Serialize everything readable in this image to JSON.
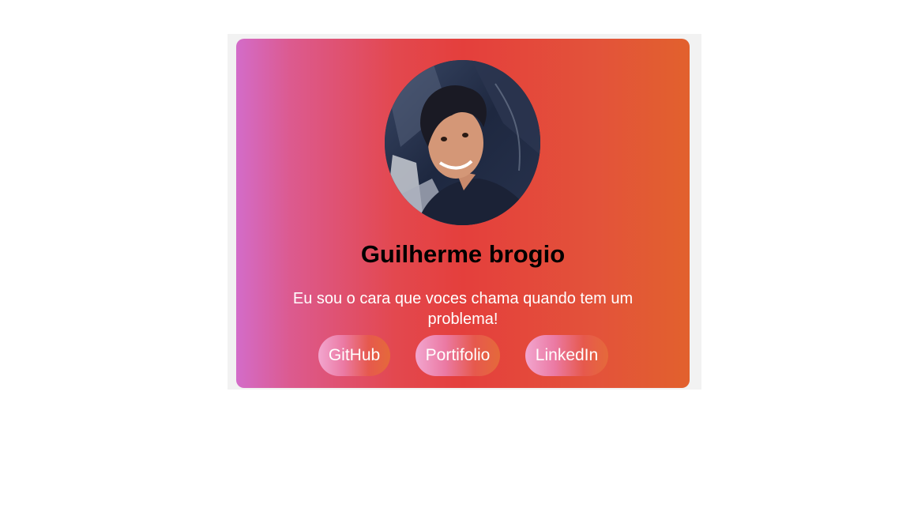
{
  "profile": {
    "name": "Guilherme brogio",
    "bio": "Eu sou o cara que voces chama quando tem um problema!",
    "avatar_alt": "profile photo"
  },
  "links": [
    {
      "label": "GitHub"
    },
    {
      "label": "Portifolio"
    },
    {
      "label": "LinkedIn"
    }
  ],
  "colors": {
    "card_gradient_start": "#d36cc9",
    "card_gradient_mid": "#e43f3c",
    "card_gradient_end": "#e2612d",
    "name_text": "#000000",
    "bio_text": "#ffffff"
  }
}
